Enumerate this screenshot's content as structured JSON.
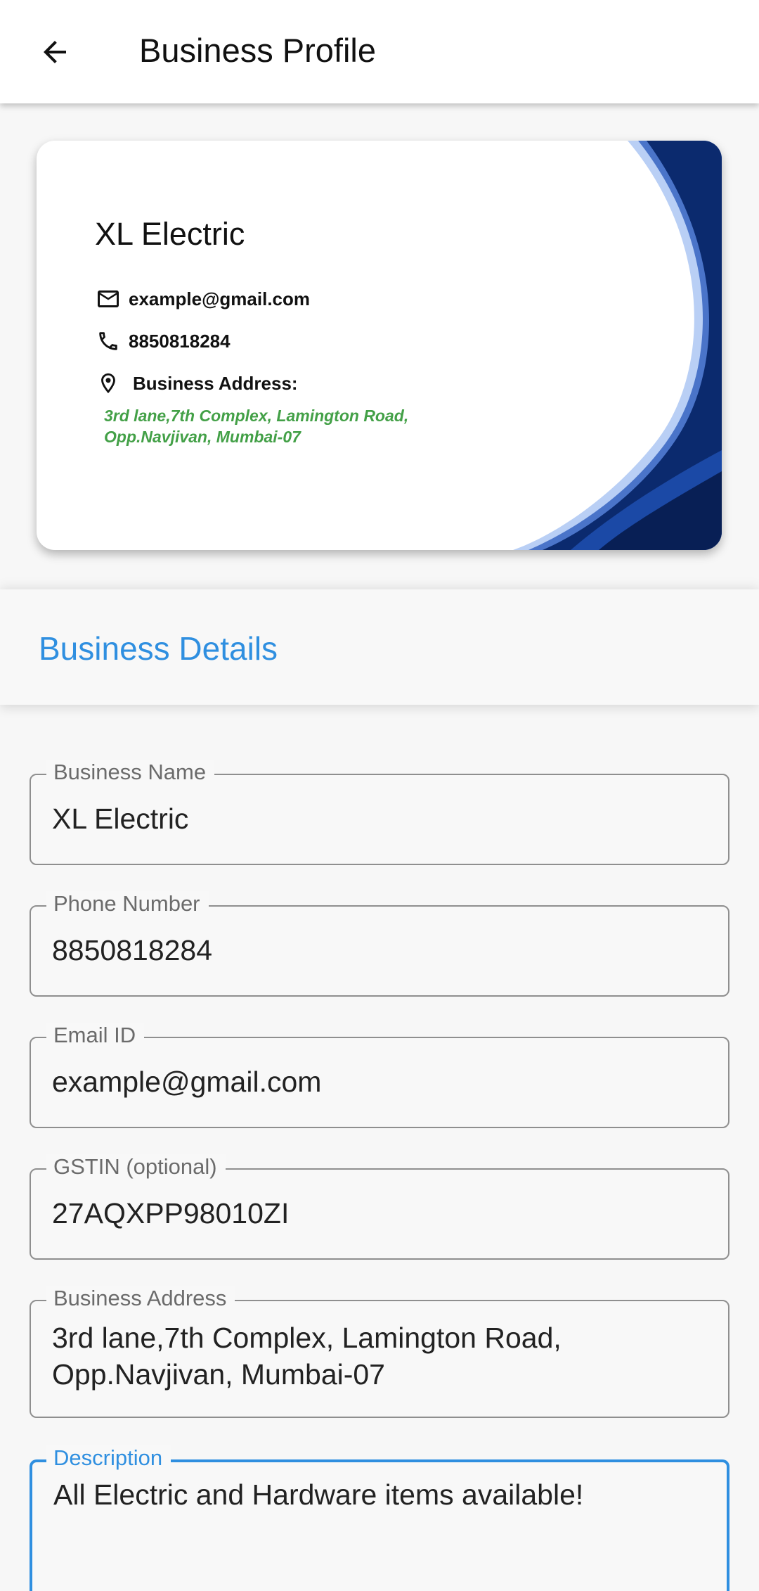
{
  "appbar": {
    "title": "Business Profile"
  },
  "card": {
    "name": "XL Electric",
    "email": "example@gmail.com",
    "phone": "8850818284",
    "address_label": "Business Address:",
    "address": "3rd lane,7th Complex, Lamington Road, Opp.Navjivan, Mumbai-07",
    "colors": {
      "wave_dark": "#0b2a6e",
      "wave_light": "#b9cff5",
      "address_text": "#43a047"
    }
  },
  "section": {
    "title": "Business Details"
  },
  "form": {
    "business_name": {
      "label": "Business Name",
      "value": "XL Electric"
    },
    "phone": {
      "label": "Phone Number",
      "value": "8850818284"
    },
    "email": {
      "label": "Email ID",
      "value": "example@gmail.com"
    },
    "gstin": {
      "label": "GSTIN (optional)",
      "value": "27AQXPP98010ZI"
    },
    "address": {
      "label": "Business Address",
      "line1": "3rd lane,7th Complex, Lamington Road,",
      "line2": "Opp.Navjivan, Mumbai-07"
    },
    "description": {
      "label": "Description",
      "value": "All Electric and Hardware items available!"
    }
  },
  "icons": [
    "arrow-back-icon",
    "mail-icon",
    "phone-icon",
    "location-pin-icon"
  ],
  "accent_color": "#2f8fe0"
}
